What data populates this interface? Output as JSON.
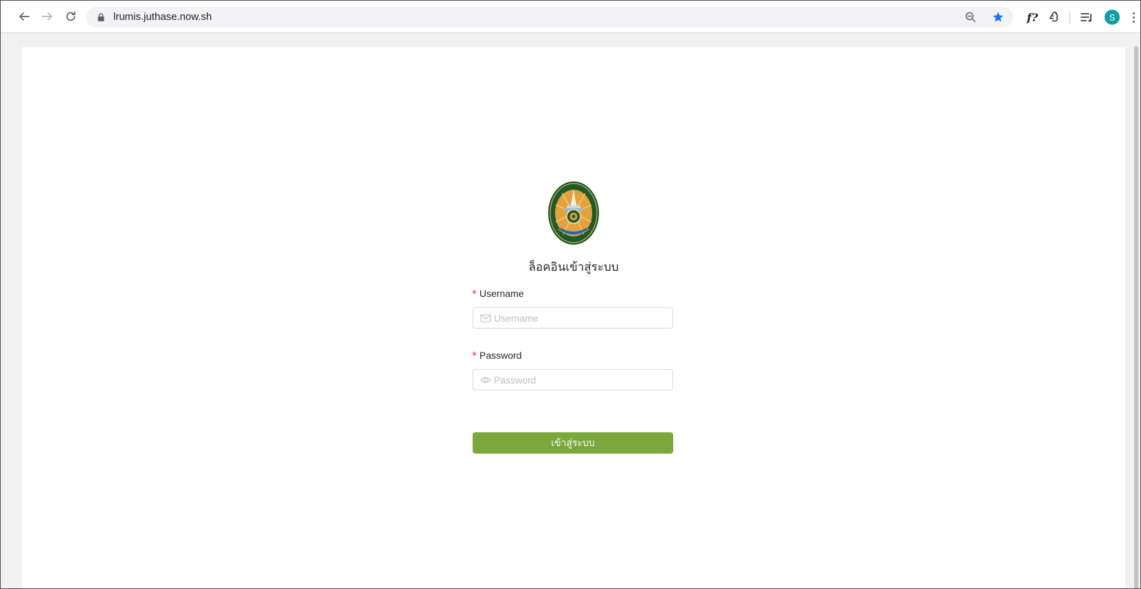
{
  "browser": {
    "url": "lrumis.juthase.now.sh",
    "profile_initial": "S",
    "extension_formula_label": "f?",
    "icons": [
      "back-arrow-icon",
      "forward-arrow-icon",
      "reload-icon",
      "lock-icon",
      "zoom-out-icon",
      "bookmark-star-icon",
      "formula-extension-icon",
      "recycle-extension-icon",
      "media-queue-icon",
      "avatar",
      "menu-kebab-icon"
    ],
    "colors": {
      "star": "#1a73e8",
      "avatar": "#0e9fa6"
    }
  },
  "login": {
    "title": "ล็อคอินเข้าสู่ระบบ",
    "username_label": "Username",
    "username_placeholder": "Username",
    "password_label": "Password",
    "password_placeholder": "Password",
    "required_mark": "*",
    "submit_label": "เข้าสู่ระบบ",
    "submit_color": "#7aa83a",
    "required_color": "#f5222d"
  }
}
